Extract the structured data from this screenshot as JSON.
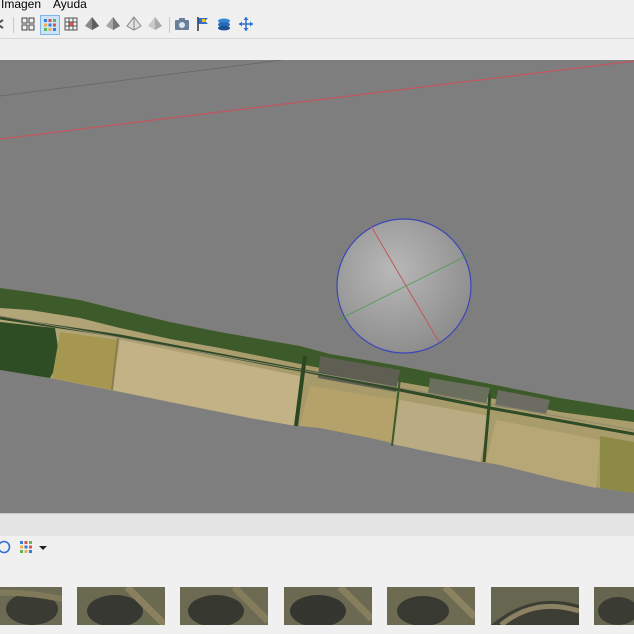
{
  "menu": {
    "items": [
      "Imagen",
      "Ayuda"
    ]
  },
  "toolbar": {
    "buttons": [
      {
        "icon": "undo-icon"
      },
      {
        "icon": "grid-4-icon"
      },
      {
        "icon": "grid-colored-icon",
        "active": true
      },
      {
        "icon": "grid-dense-icon"
      },
      {
        "icon": "pyramid-solid-icon"
      },
      {
        "icon": "pyramid-shaded-icon"
      },
      {
        "icon": "pyramid-wire-icon"
      },
      {
        "icon": "pyramid-light-icon"
      },
      {
        "icon": "camera-icon"
      },
      {
        "icon": "flag-icon"
      },
      {
        "icon": "layers-icon"
      },
      {
        "icon": "move-icon"
      }
    ]
  },
  "photos_toolbar": {
    "buttons": [
      {
        "icon": "rotate-icon"
      },
      {
        "icon": "thumbnail-grid-icon"
      },
      {
        "icon": "dropdown-arrow-icon"
      }
    ]
  },
  "thumbnails": {
    "count": 7
  },
  "colors": {
    "viewport_bg": "#7e7e7e",
    "axis_red": "#c2555d",
    "axis_green": "#3f9b3f",
    "sphere_outline": "#3b45b8",
    "toolbar_active": "#cde4f7"
  }
}
